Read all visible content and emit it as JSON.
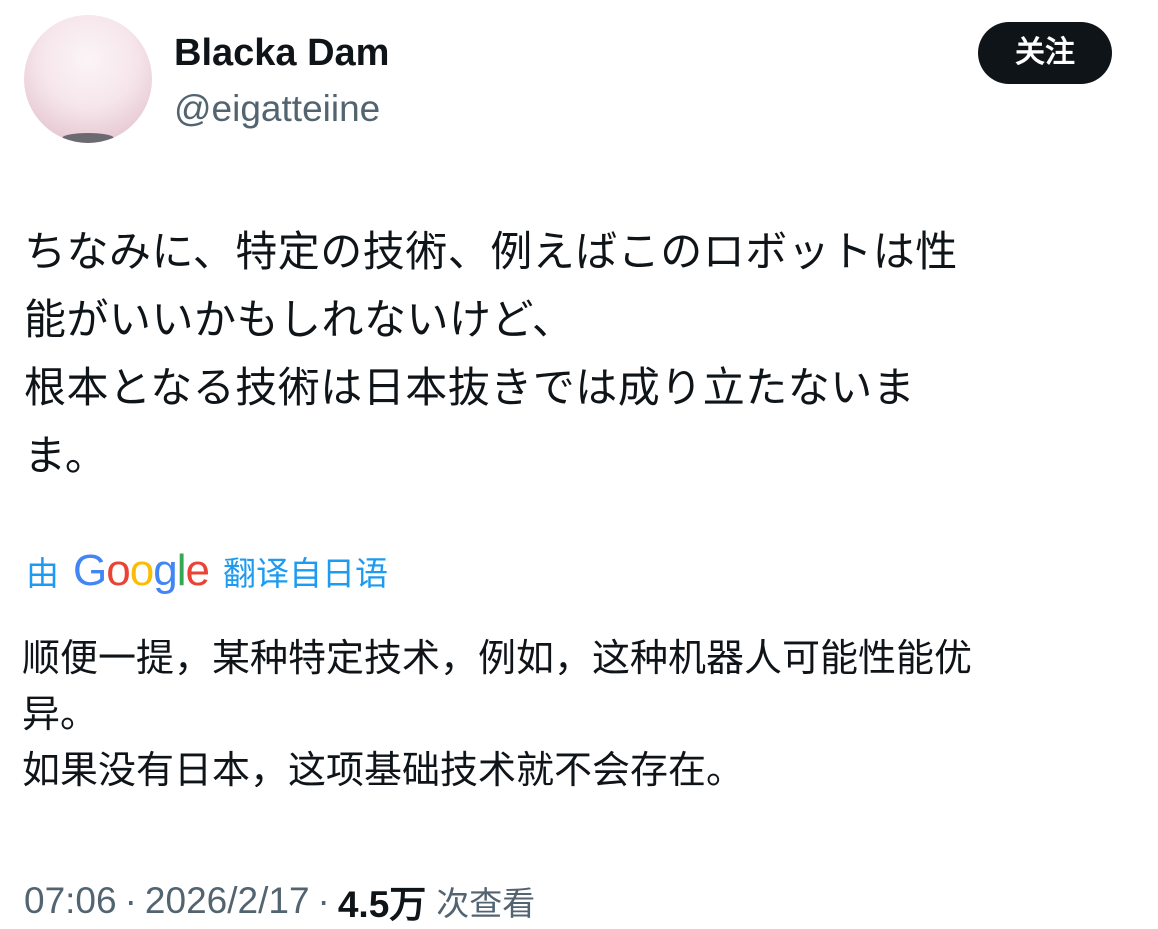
{
  "tweet": {
    "author": {
      "display_name": "Blacka Dam",
      "handle": "@eigatteiine"
    },
    "follow_label": "关注",
    "original_text": [
      "ちなみに、特定の技術、例えばこのロボットは性",
      "能がいいかもしれないけど、",
      "根本となる技術は日本抜きでは成り立たないま",
      "ま。"
    ],
    "translation": {
      "prefix": "由",
      "provider": "Google",
      "suffix": "翻译自日语"
    },
    "translated_text": [
      "顺便一提，某种特定技术，例如，这种机器人可能性能优",
      "异。",
      "如果没有日本，这项基础技术就不会存在。"
    ],
    "meta": {
      "time": "07:06",
      "date": "2026/2/17",
      "views_count": "4.5万",
      "views_label": "次查看"
    }
  }
}
